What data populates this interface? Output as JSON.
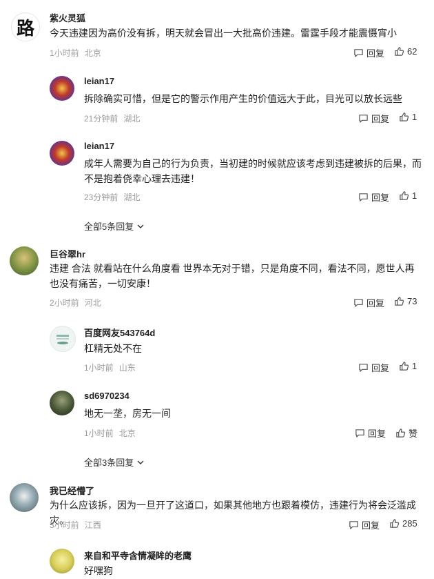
{
  "reply_label": "回复",
  "comments": [
    {
      "user": "紫火灵狐",
      "avatar_char": "路",
      "text": "今天违建因为高价没有拆，明天就会冒出一大批高价违建。雷霆手段才能震慑宵小",
      "time": "1小时前",
      "location": "北京",
      "likes": "62",
      "replies": [
        {
          "user": "leian17",
          "text": "拆除确实可惜，但是它的警示作用产生的价值远大于此，目光可以放长远些",
          "time": "21分钟前",
          "location": "湖北",
          "likes": "1"
        },
        {
          "user": "leian17",
          "text": "成年人需要为自己的行为负责，当初建的时候就应该考虑到违建被拆的后果，而不是抱着侥幸心理去违建！",
          "time": "23分钟前",
          "location": "湖北",
          "likes": "1"
        }
      ],
      "expand": "全部5条回复"
    },
    {
      "user": "巨谷翠hr",
      "text": "违建 合法 就看站在什么角度看 世界本无对于错，只是角度不同，看法不同，愿世人再也没有痛苦，一切安康！",
      "time": "2小时前",
      "location": "河北",
      "likes": "73",
      "replies": [
        {
          "user": "百度网友543764d",
          "text": "杠精无处不在",
          "time": "1小时前",
          "location": "山东",
          "likes": "1"
        },
        {
          "user": "sd6970234",
          "text": "地无一垄，房无一间",
          "time": "1小时前",
          "location": "北京",
          "likes": "赞"
        }
      ],
      "expand": "全部3条回复"
    },
    {
      "user": "我已经懵了",
      "text": "为什么应该拆，因为一旦开了这道口，如果其他地方也跟着模仿，违建行为将会泛滥成灾。",
      "time": "3小时前",
      "location": "江西",
      "likes": "285",
      "replies": [
        {
          "user": "来自和平寺含情凝眸的老鹰",
          "text": "好嘿狗"
        }
      ]
    }
  ]
}
